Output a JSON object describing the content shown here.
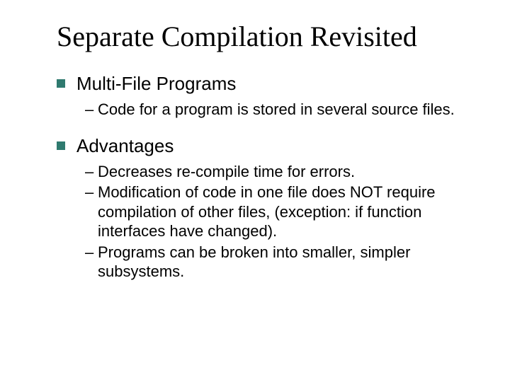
{
  "title": "Separate Compilation Revisited",
  "colors": {
    "bullet": "#2f7a6f"
  },
  "sections": [
    {
      "heading": "Multi-File Programs",
      "items": [
        "Code for a program is stored in several source files."
      ]
    },
    {
      "heading": "Advantages",
      "items": [
        "Decreases re-compile time for errors.",
        "Modification of code in one file does NOT require compilation of other files, (exception: if function interfaces have changed).",
        "Programs can be broken into smaller, simpler subsystems."
      ]
    }
  ]
}
